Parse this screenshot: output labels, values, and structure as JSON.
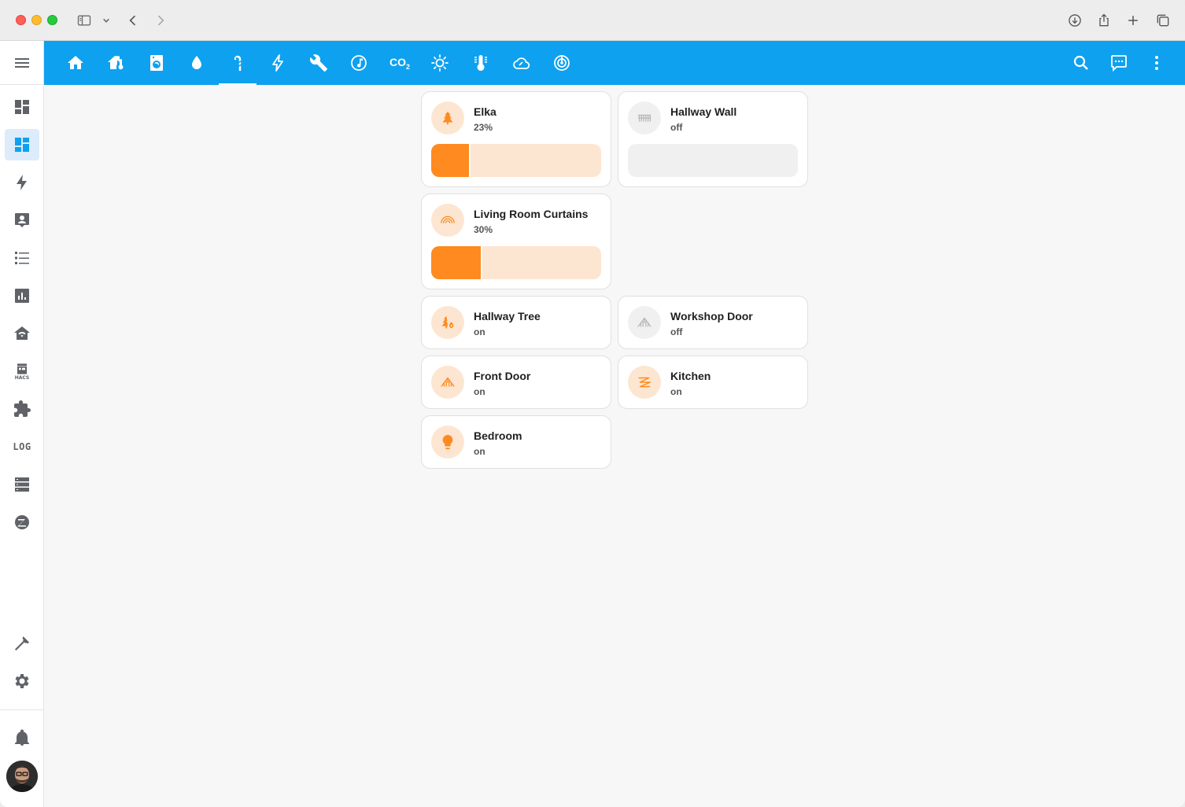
{
  "browser": {
    "nav": [
      "sidebar-toggle-icon",
      "chevron-down-icon",
      "back-icon",
      "forward-icon"
    ],
    "actions": [
      "download-icon",
      "share-icon",
      "new-tab-icon",
      "tabs-overview-icon"
    ]
  },
  "sidebar": {
    "items": [
      "menu-icon",
      "dashboard-icon",
      "dashboard-icon",
      "energy-icon",
      "map-icon",
      "logbook-icon",
      "history-icon",
      "home-wifi-icon",
      "hacs-icon",
      "puzzle-icon",
      "log-icon",
      "server-icon",
      "zigbee-icon",
      "developer-tools-icon",
      "settings-icon",
      "bell-icon"
    ],
    "hacs_label": "HACS",
    "log_label": "LOG",
    "active_index": 1
  },
  "toolbar": {
    "tabs": [
      "home-icon",
      "home-thermometer-icon",
      "washing-machine-icon",
      "water-icon",
      "candy-cane-icon",
      "lightning-icon",
      "wrench-icon",
      "music-icon",
      "co2-icon",
      "sun-icon",
      "thermometer-icon",
      "cloud-icon",
      "radar-icon"
    ],
    "co2_label": "CO",
    "co2_sub": "2",
    "active_tab": 4,
    "right_actions": [
      "search-icon",
      "assist-icon",
      "dots-vertical-icon"
    ]
  },
  "cards": [
    {
      "name": "Elka",
      "state": "23%",
      "icon": "pine-tree-icon",
      "on": true,
      "slider": 0.23
    },
    {
      "name": "Hallway Wall",
      "state": "off",
      "icon": "string-lights-icon",
      "on": false,
      "slider": 0
    },
    {
      "name": "Living Room Curtains",
      "state": "30%",
      "icon": "rainbow-lights-icon",
      "on": true,
      "slider": 0.3
    },
    {
      "name": "Hallway Tree",
      "state": "on",
      "icon": "tree-fire-icon",
      "on": true
    },
    {
      "name": "Workshop Door",
      "state": "off",
      "icon": "icicle-lights-icon",
      "on": false
    },
    {
      "name": "Front Door",
      "state": "on",
      "icon": "icicle-lights-icon",
      "on": true
    },
    {
      "name": "Kitchen",
      "state": "on",
      "icon": "zigzag-lights-icon",
      "on": true
    },
    {
      "name": "Bedroom",
      "state": "on",
      "icon": "lightbulb-icon",
      "on": true
    }
  ],
  "colors": {
    "toolbar": "#0ea1ef",
    "accent_on": "#ff8a1f",
    "accent_on_bg": "#fde6d1",
    "off_icon": "#c4c4c4"
  }
}
